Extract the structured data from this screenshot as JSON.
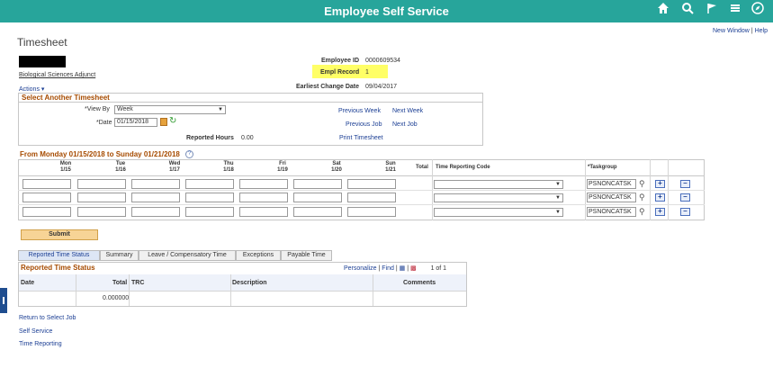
{
  "header": {
    "title": "Employee Self Service",
    "icons": [
      "home-icon",
      "search-icon",
      "flag-icon",
      "menu-icon",
      "compass-icon"
    ]
  },
  "top_links": {
    "new_window": "New Window",
    "sep": "|",
    "help": "Help"
  },
  "page_title": "Timesheet",
  "employee": {
    "job_title": "Biological Sciences Adjunct",
    "id_label": "Employee ID",
    "id_value": "0000609534",
    "record_label": "Empl Record",
    "record_value": "1",
    "change_label": "Earliest Change Date",
    "change_value": "09/04/2017"
  },
  "actions": "Actions",
  "select_timesheet": {
    "header": "Select Another Timesheet",
    "view_by_label": "*View By",
    "view_by_value": "Week",
    "date_label": "*Date",
    "date_value": "01/15/2018",
    "reported_hours_label": "Reported Hours",
    "reported_hours_value": "0.00",
    "prev_week": "Previous Week",
    "next_week": "Next Week",
    "prev_job": "Previous Job",
    "next_job": "Next Job",
    "print": "Print Timesheet"
  },
  "week": {
    "header": "From Monday 01/15/2018 to Sunday 01/21/2018",
    "help": "?",
    "days": [
      {
        "day": "Mon",
        "date": "1/15"
      },
      {
        "day": "Tue",
        "date": "1/16"
      },
      {
        "day": "Wed",
        "date": "1/17"
      },
      {
        "day": "Thu",
        "date": "1/18"
      },
      {
        "day": "Fri",
        "date": "1/19"
      },
      {
        "day": "Sat",
        "date": "1/20"
      },
      {
        "day": "Sun",
        "date": "1/21"
      }
    ],
    "total_label": "Total",
    "trc_label": "Time Reporting Code",
    "taskgroup_label": "*Taskgroup",
    "rows": [
      {
        "taskgroup": "PSNONCATSK"
      },
      {
        "taskgroup": "PSNONCATSK"
      },
      {
        "taskgroup": "PSNONCATSK"
      }
    ]
  },
  "submit": "Submit",
  "tabs": [
    "Reported Time Status",
    "Summary",
    "Leave / Compensatory Time",
    "Exceptions",
    "Payable Time"
  ],
  "reported_status": {
    "header": "Reported Time Status",
    "personalize": "Personalize",
    "find": "Find",
    "pager": "1 of 1",
    "columns": [
      "Date",
      "Total",
      "TRC",
      "Description",
      "Comments"
    ],
    "row": {
      "total": "0.000000"
    }
  },
  "bottom_links": [
    "Return to Select Job",
    "Self Service",
    "Time Reporting"
  ],
  "colors": {
    "topbar": "#27a59b",
    "section_header": "#a64b00",
    "link": "#1c3f94",
    "highlight": "#ffff66"
  }
}
